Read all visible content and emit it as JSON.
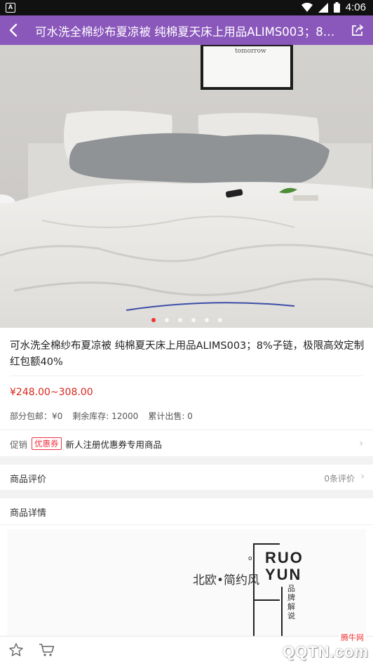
{
  "status_bar": {
    "time": "4:06",
    "left_icon_letter": "A",
    "icons": [
      "wifi-icon",
      "signal-icon",
      "battery-icon"
    ]
  },
  "header": {
    "title": "可水洗全棉纱布夏凉被 纯棉夏天床上用品ALIMS003；8%子链，极限高效定制红包额40%",
    "back_icon": "back-chevron-icon",
    "share_icon": "share-icon"
  },
  "hero": {
    "picture_text": "tomorrow",
    "carousel_count": 6,
    "carousel_active_index": 0
  },
  "product": {
    "name": "可水洗全棉纱布夏凉被 纯棉夏天床上用品ALIMS003；8%子链，极限高效定制红包额40%",
    "price": "¥248.00~308.00",
    "shipping": "部分包邮：¥0",
    "stock": "剩余库存: 12000",
    "sold": "累计出售: 0"
  },
  "promotion": {
    "label": "促销",
    "badge": "优惠券",
    "text": "新人注册优惠券专用商品"
  },
  "reviews": {
    "label": "商品评价",
    "count": "0条评价"
  },
  "details": {
    "label": "商品详情",
    "banner": {
      "tagline": "北欧•简约风",
      "small_o": "o",
      "brand_line1": "RUO",
      "brand_line2": "YUN",
      "vertical_text": "品牌解说"
    }
  },
  "bottom_bar": {
    "favorite_icon": "star-icon",
    "cart_icon": "cart-icon"
  },
  "watermark": {
    "line1": "腾牛网",
    "line2": "QQTN.com"
  },
  "colors": {
    "header_bg": "#8a57bb",
    "price": "#d9261c",
    "badge": "#e33344",
    "carousel_active": "#ee3333"
  }
}
